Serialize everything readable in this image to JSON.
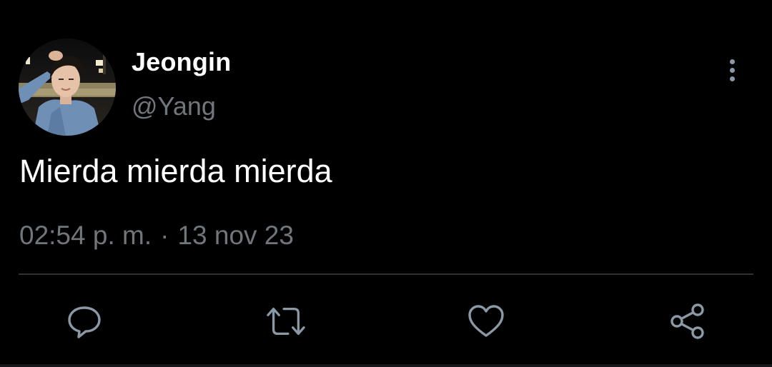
{
  "tweet": {
    "display_name": "Jeongin",
    "handle": "@Yang",
    "text": "Mierda mierda mierda",
    "time": "02:54 p. m.",
    "separator": "·",
    "date": "13 nov 23"
  },
  "icons": {
    "avatar": "profile-photo",
    "more": "more-vertical-icon",
    "reply": "reply-icon",
    "retweet": "retweet-icon",
    "like": "heart-icon",
    "share": "share-icon"
  },
  "colors": {
    "background": "#000000",
    "primary_text": "#ffffff",
    "secondary_text": "#71767b",
    "icon": "#8b98a5",
    "divider": "#2f3336"
  }
}
